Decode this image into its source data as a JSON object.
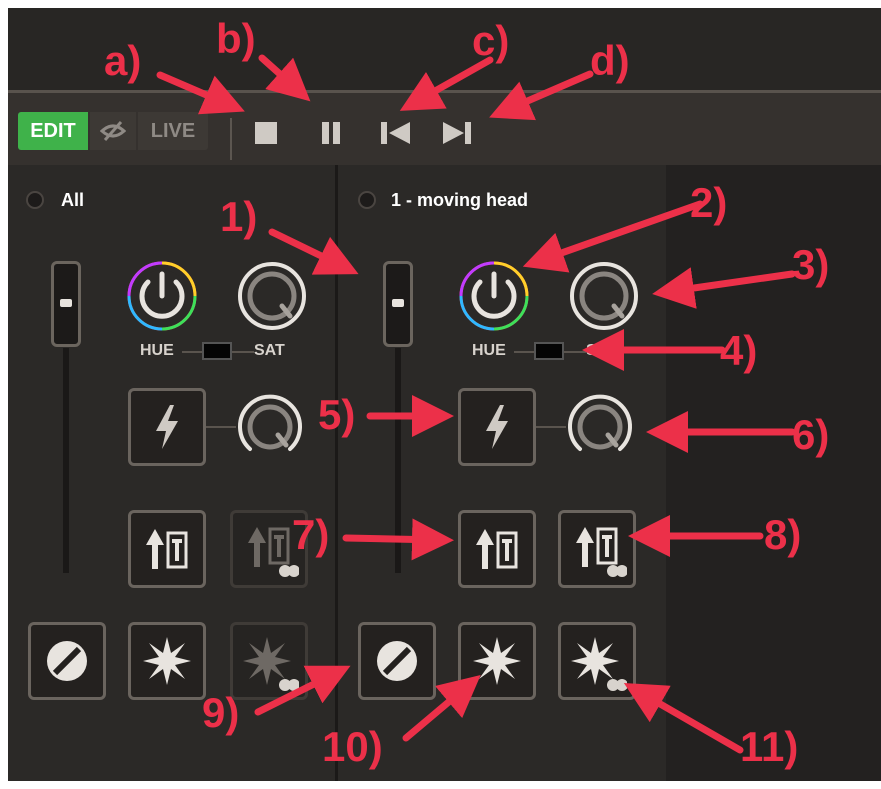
{
  "toolbar": {
    "edit_label": "EDIT",
    "live_label": "LIVE",
    "icons": [
      "stop-icon",
      "pause-icon",
      "skip-previous-icon",
      "skip-next-icon"
    ]
  },
  "columns": [
    {
      "name": "All",
      "hue_label": "HUE",
      "sat_label": "SAT"
    },
    {
      "name": "1 - moving head",
      "hue_label": "HUE",
      "sat_label": "SAT"
    }
  ],
  "callouts": {
    "a": "a)",
    "b": "b)",
    "c": "c)",
    "d": "d)",
    "n1": "1)",
    "n2": "2)",
    "n3": "3)",
    "n4": "4)",
    "n5": "5)",
    "n6": "6)",
    "n7": "7)",
    "n8": "8)",
    "n9": "9)",
    "n10": "10)",
    "n11": "11)"
  },
  "colors": {
    "edit_green": "#3fb24a",
    "annotation_red": "#ec3049",
    "panel": "#2b2927",
    "toolbar": "#35312e"
  }
}
